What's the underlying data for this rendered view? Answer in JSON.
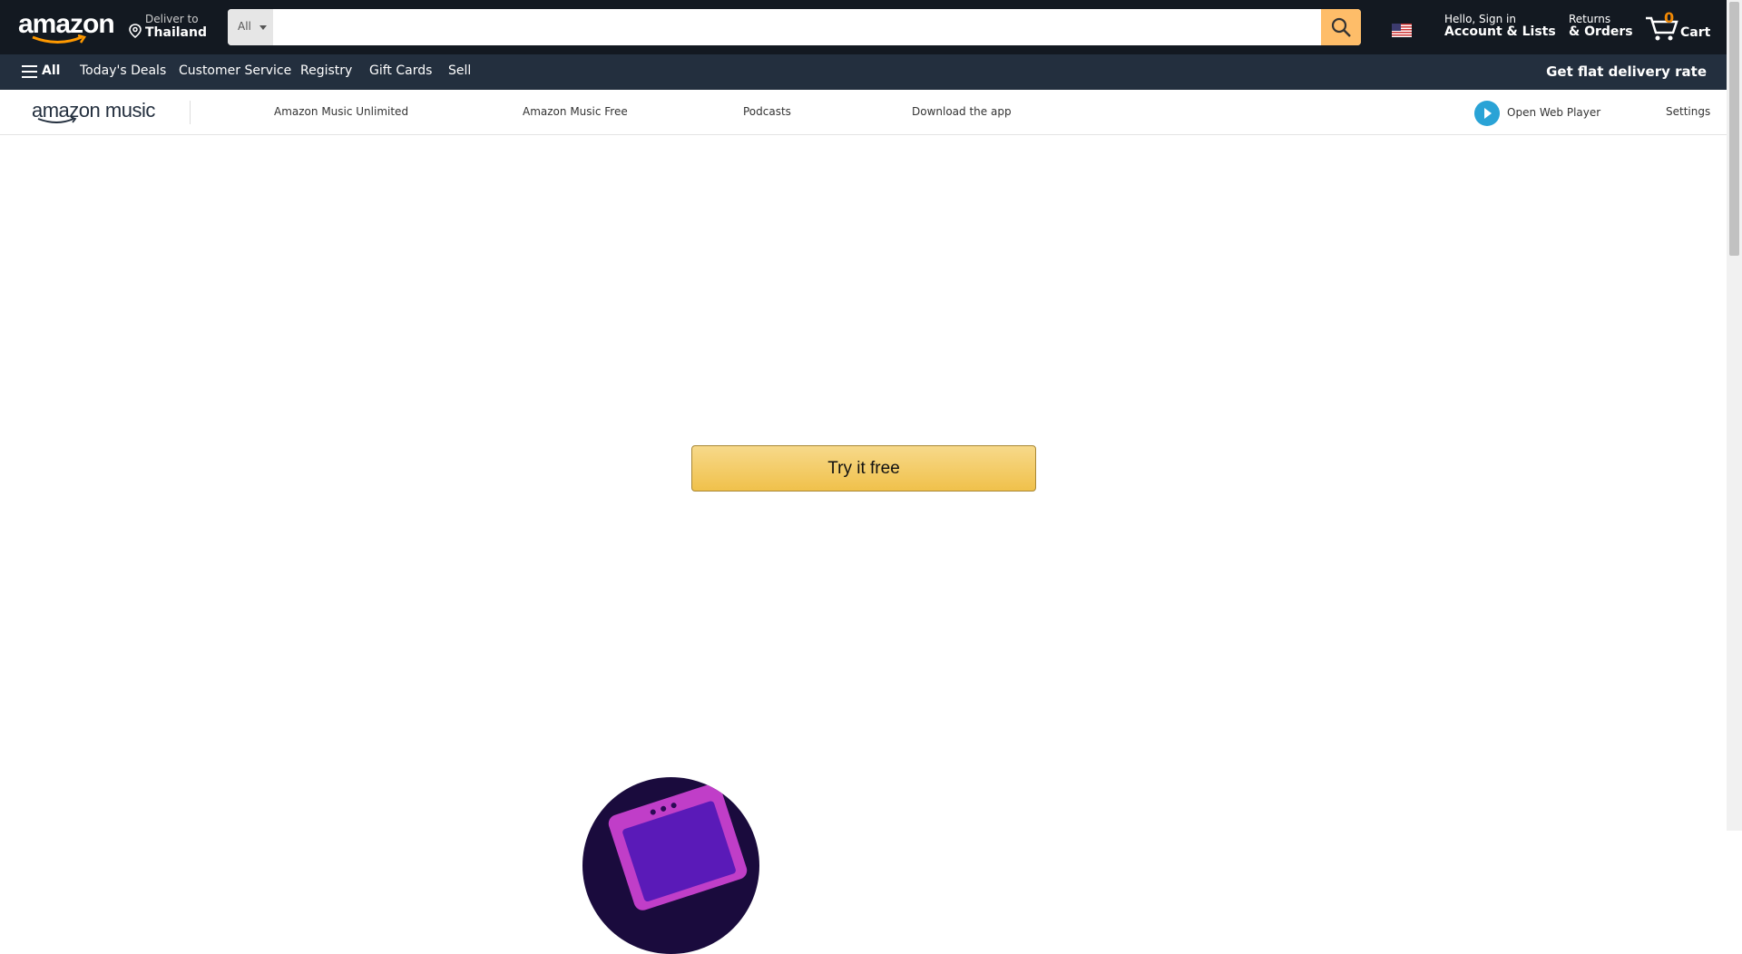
{
  "header": {
    "logo_text": "amazon",
    "deliver_line1": "Deliver to",
    "deliver_line2": "Thailand",
    "search_category": "All",
    "search_placeholder": "",
    "account_line1": "Hello, Sign in",
    "account_line2": "Account & Lists",
    "returns_line1": "Returns",
    "returns_line2": "& Orders",
    "cart_count": "0",
    "cart_label": "Cart",
    "accent_color": "#febd69"
  },
  "subnav": {
    "all": "All",
    "items": [
      "Today's Deals",
      "Customer Service",
      "Registry",
      "Gift Cards",
      "Sell"
    ],
    "promo": "Get flat delivery rate"
  },
  "music_nav": {
    "logo_text": "amazon music",
    "links": [
      "Amazon Music Unlimited",
      "Amazon Music Free",
      "Podcasts",
      "Download the app"
    ],
    "web_player": "Open Web Player",
    "settings": "Settings"
  },
  "main": {
    "cta": "Try it free"
  },
  "icons": [
    "location-pin-icon",
    "search-icon",
    "us-flag-icon",
    "cart-icon",
    "hamburger-icon",
    "play-icon"
  ]
}
